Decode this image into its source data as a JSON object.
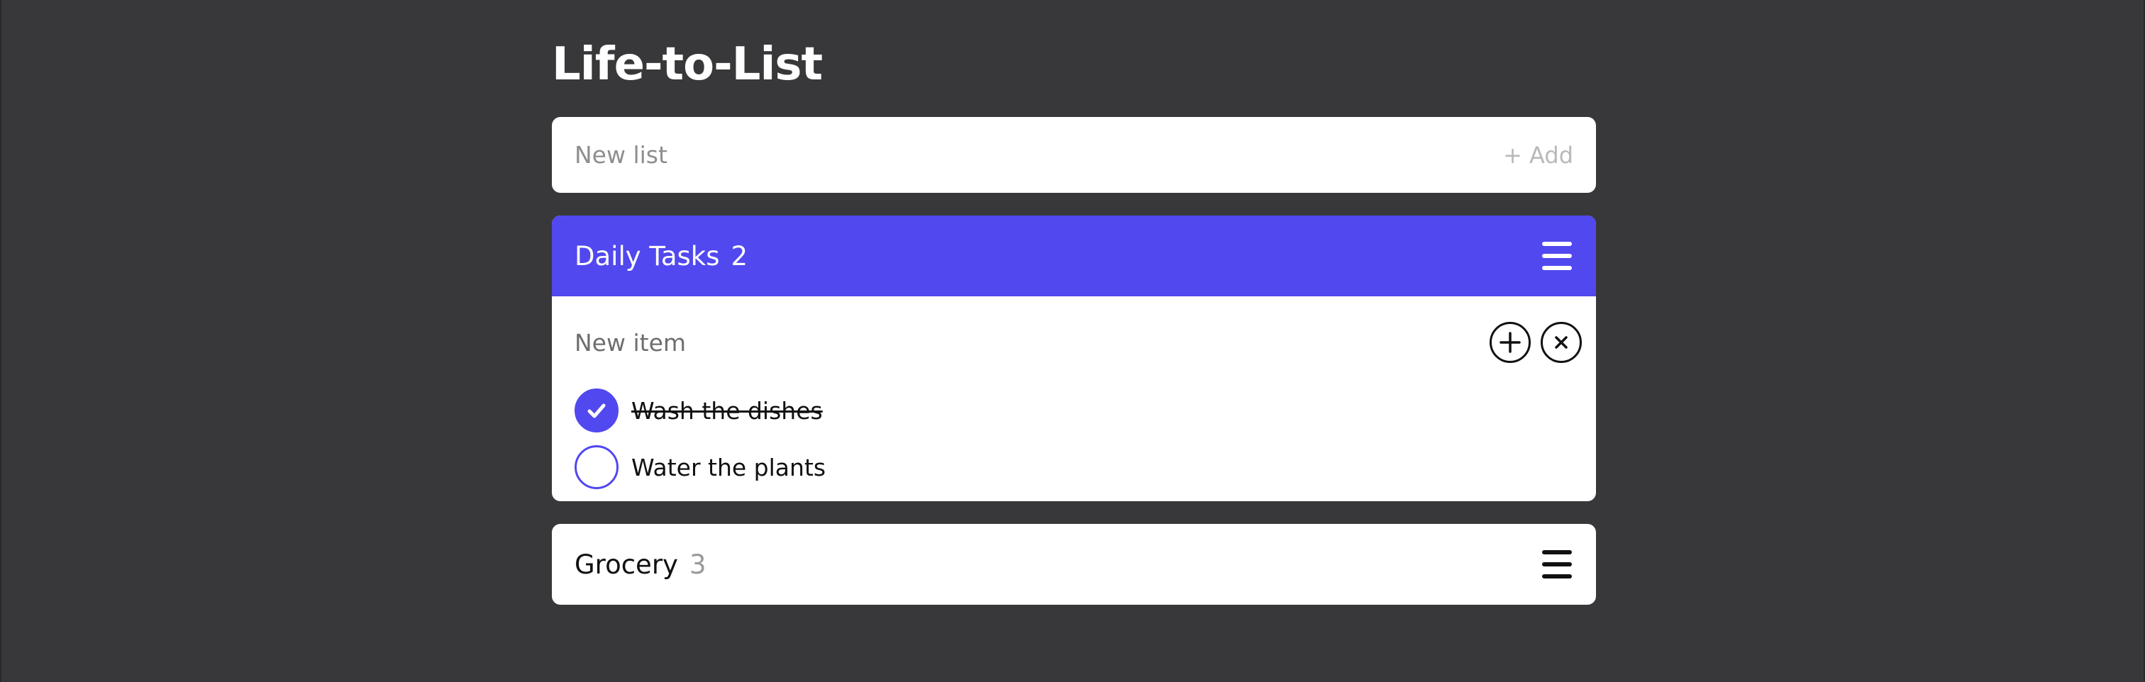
{
  "app": {
    "title": "Life-to-List"
  },
  "new_list": {
    "placeholder": "New list",
    "value": "",
    "add_label": "+ Add"
  },
  "lists": [
    {
      "name": "Daily Tasks",
      "count": "2",
      "active": true,
      "new_item": {
        "placeholder": "New item",
        "value": ""
      },
      "items": [
        {
          "text": "Wash the dishes",
          "done": true
        },
        {
          "text": "Water the plants",
          "done": false
        }
      ]
    },
    {
      "name": "Grocery",
      "count": "3",
      "active": false
    }
  ],
  "colors": {
    "background": "#38383a",
    "accent": "#5148ef",
    "card": "#ffffff",
    "muted_text": "#9a9a9a"
  },
  "icons": {
    "menu": "hamburger-menu-icon",
    "add_item": "plus-circle-icon",
    "cancel_item": "close-circle-icon",
    "checked": "checkmark-icon"
  }
}
